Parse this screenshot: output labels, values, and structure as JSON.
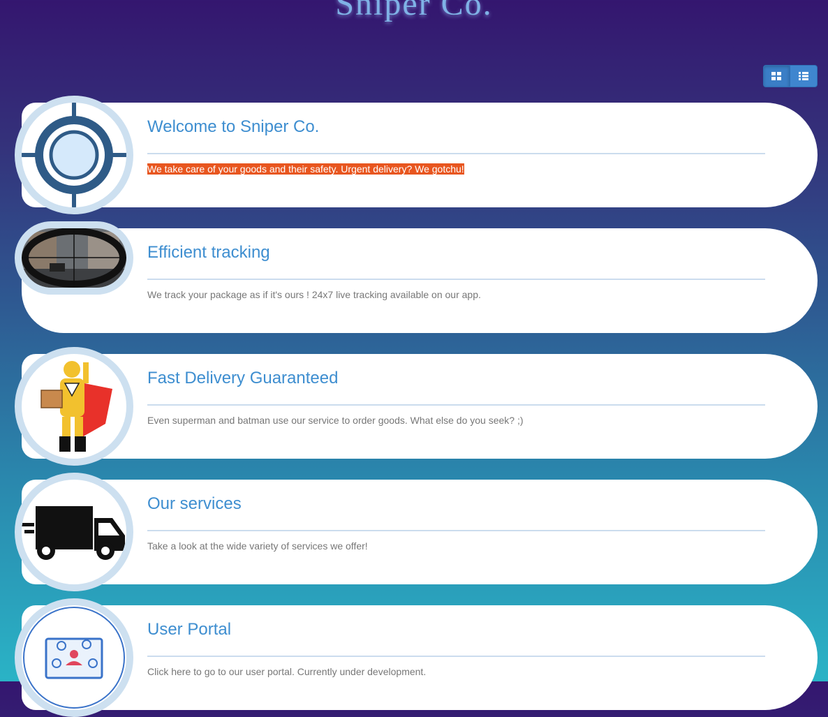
{
  "brand": "Sniper Co.",
  "cards": [
    {
      "title": "Welcome to Sniper Co.",
      "text": "We take care of your goods and their safety. Urgent delivery? We gotchu!",
      "icon": "crosshair-icon"
    },
    {
      "title": "Efficient tracking",
      "text": "We track your package as if it's ours ! 24x7 live tracking available on our app.",
      "icon": "scope-view-image"
    },
    {
      "title": "Fast Delivery Guaranteed",
      "text": "Even superman and batman use our service to order goods. What else do you seek? ;)",
      "icon": "superhero-courier-image"
    },
    {
      "title": "Our services",
      "text": "Take a look at the wide variety of services we offer!",
      "icon": "truck-icon"
    },
    {
      "title": "User Portal",
      "text": "Click here to go to our user portal. Currently under development.",
      "icon": "portal-icon"
    }
  ],
  "colors": {
    "accent": "#3e8ed0",
    "highlight": "#e8561f"
  }
}
